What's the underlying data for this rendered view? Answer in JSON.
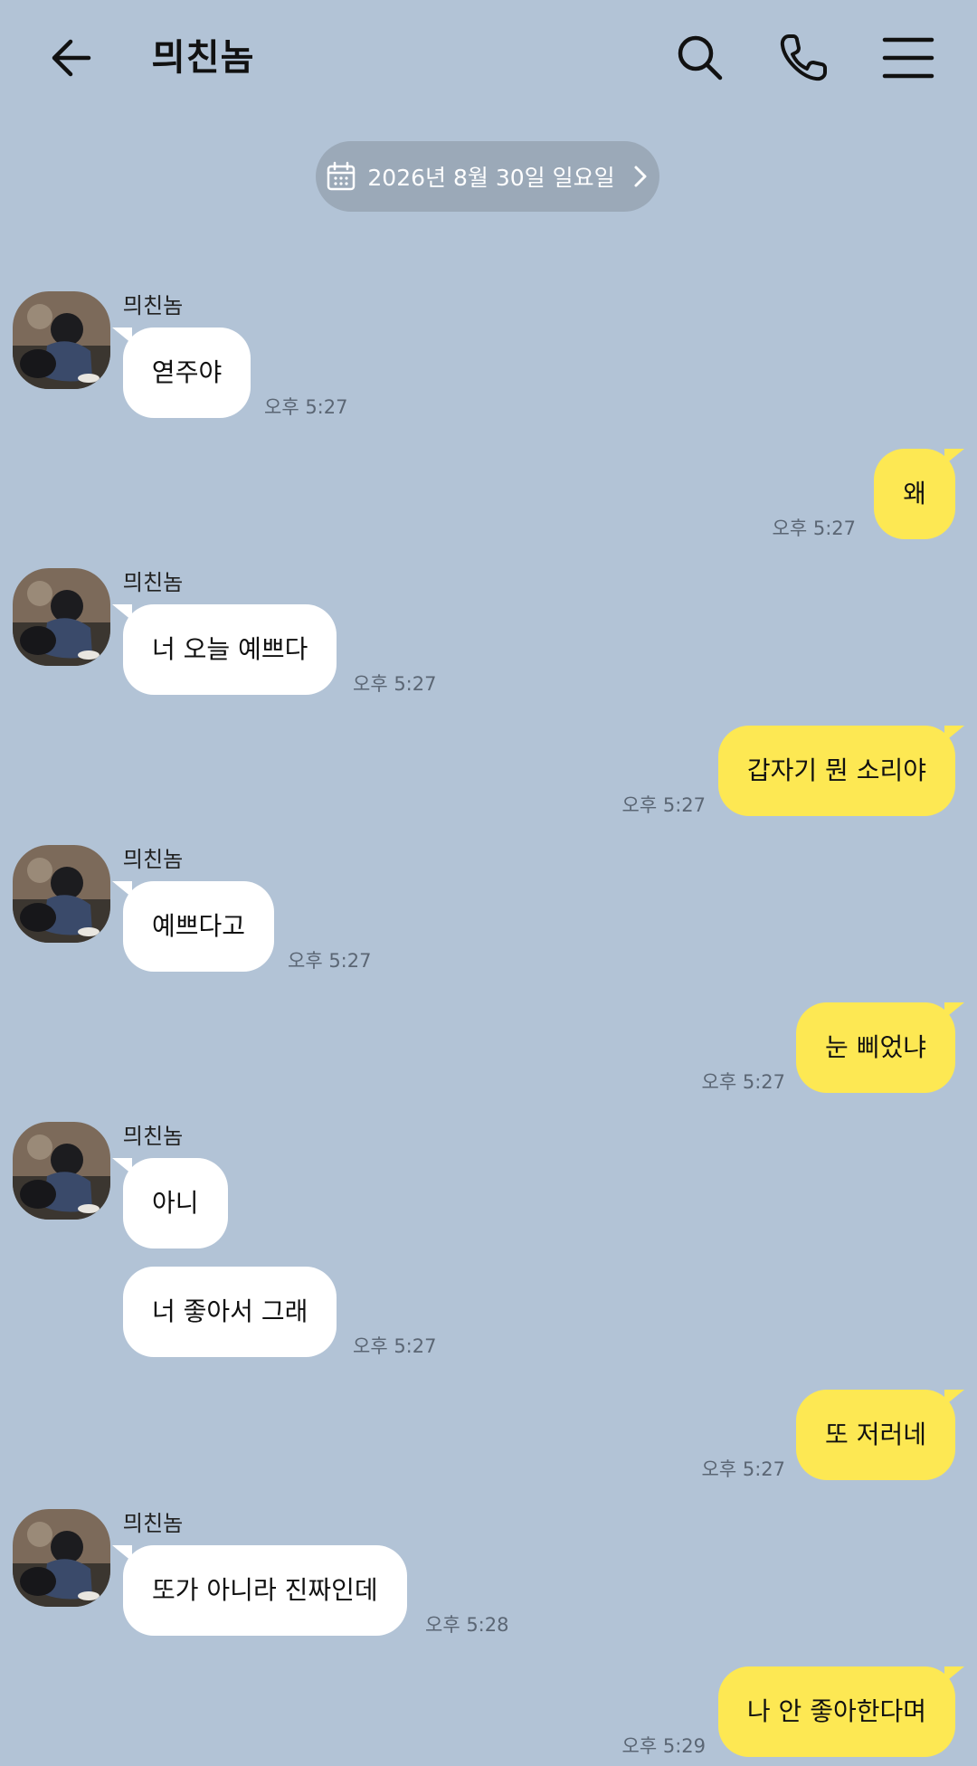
{
  "header": {
    "title": "믜친놈",
    "back_icon": "arrow-left-icon",
    "search_icon": "search-icon",
    "call_icon": "phone-icon",
    "menu_icon": "hamburger-menu-icon"
  },
  "date_divider": {
    "label": "2026년 8월 30일 일요일",
    "icon": "calendar-icon"
  },
  "colors": {
    "background": "#b2c3d6",
    "incoming_bubble": "#ffffff",
    "outgoing_bubble": "#fde853",
    "date_pill": "#9ba9b8"
  },
  "messages": [
    {
      "direction": "in",
      "sender": "믜친놈",
      "text": "엳주야",
      "time": "오후 5:27"
    },
    {
      "direction": "out",
      "text": "왜",
      "time": "오후 5:27"
    },
    {
      "direction": "in",
      "sender": "믜친놈",
      "text": "너 오늘 예쁘다",
      "time": "오후 5:27"
    },
    {
      "direction": "out",
      "text": "갑자기 뭔 소리야",
      "time": "오후 5:27"
    },
    {
      "direction": "in",
      "sender": "믜친놈",
      "text": "예쁘다고",
      "time": "오후 5:27"
    },
    {
      "direction": "out",
      "text": "눈 삐었냐",
      "time": "오후 5:27"
    },
    {
      "direction": "in",
      "sender": "믜친놈",
      "text": "아니"
    },
    {
      "direction": "in",
      "text": "너 좋아서 그래",
      "time": "오후 5:27"
    },
    {
      "direction": "out",
      "text": "또 저러네",
      "time": "오후 5:27"
    },
    {
      "direction": "in",
      "sender": "믜친놈",
      "text": "또가 아니라 진짜인데",
      "time": "오후 5:28"
    },
    {
      "direction": "out",
      "text": "나 안 좋아한다며",
      "time": "오후 5:29"
    }
  ]
}
